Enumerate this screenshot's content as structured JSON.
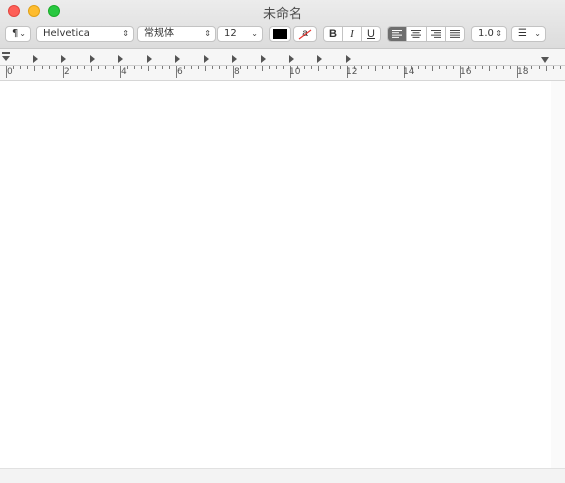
{
  "window": {
    "title": "未命名"
  },
  "toolbar": {
    "paragraph_style": "¶",
    "font_family": "Helvetica",
    "typeface": "常规体",
    "font_size": "12",
    "strike_sample": "a",
    "bold": "B",
    "italic": "I",
    "underline": "U",
    "line_spacing": "1.0",
    "list_button": "☰",
    "text_color": "#000000"
  },
  "ruler": {
    "labels": [
      "0",
      "2",
      "4",
      "6",
      "8",
      "10",
      "12",
      "14",
      "16",
      "18"
    ]
  }
}
